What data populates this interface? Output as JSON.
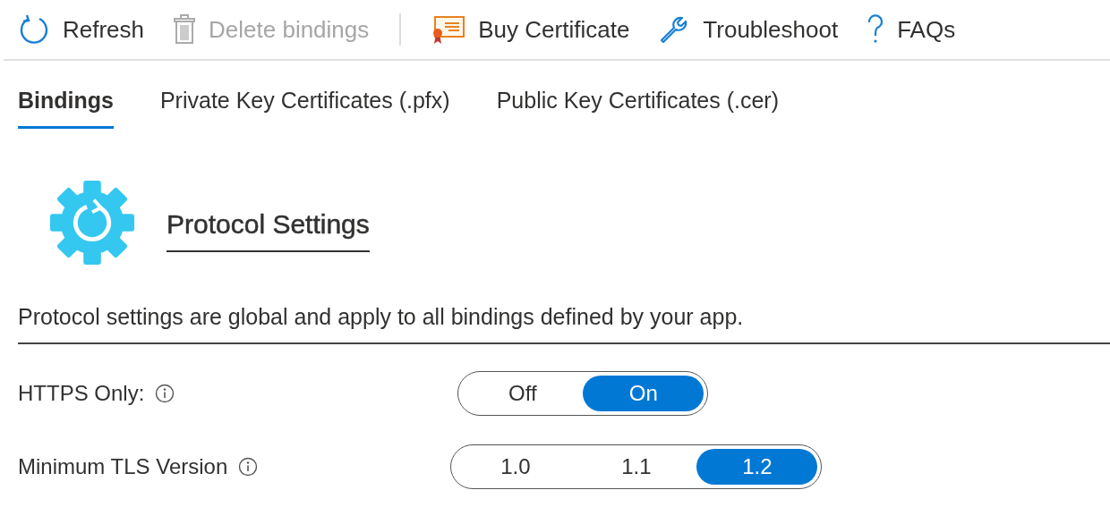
{
  "toolbar": [
    {
      "kind": "refresh",
      "label": "Refresh",
      "disabled": false
    },
    {
      "kind": "delete",
      "label": "Delete bindings",
      "disabled": true
    },
    {
      "kind": "separator"
    },
    {
      "kind": "certificate",
      "label": "Buy Certificate",
      "disabled": false
    },
    {
      "kind": "wrench",
      "label": "Troubleshoot",
      "disabled": false
    },
    {
      "kind": "help",
      "label": "FAQs",
      "disabled": false
    }
  ],
  "tabs": [
    {
      "label": "Bindings",
      "selected": true
    },
    {
      "label": "Private Key Certificates (.pfx)",
      "selected": false
    },
    {
      "label": "Public Key Certificates (.cer)",
      "selected": false
    }
  ],
  "section": {
    "title": "Protocol Settings",
    "description": "Protocol settings are global and apply to all bindings defined by your app."
  },
  "settings": [
    {
      "label": "HTTPS Only:",
      "options": [
        {
          "label": "Off",
          "selected": false
        },
        {
          "label": "On",
          "selected": true
        }
      ]
    },
    {
      "label": "Minimum TLS Version",
      "options": [
        {
          "label": "1.0",
          "selected": false
        },
        {
          "label": "1.1",
          "selected": false
        },
        {
          "label": "1.2",
          "selected": true
        }
      ]
    }
  ]
}
